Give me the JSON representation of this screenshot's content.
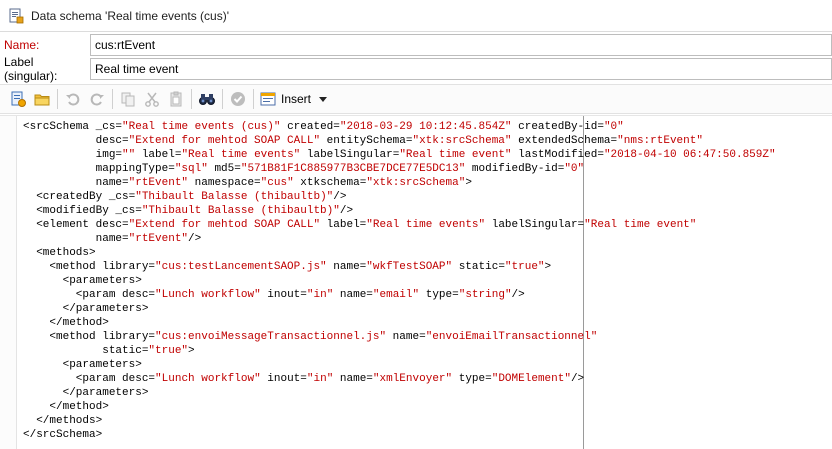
{
  "window": {
    "title": "Data schema 'Real time events (cus)'"
  },
  "form": {
    "name_label": "Name:",
    "name_value": "cus:rtEvent",
    "label_label": "Label (singular):",
    "label_value": "Real time event"
  },
  "toolbar": {
    "insert_label": "Insert",
    "icons": [
      "new-schema-icon",
      "open-folder-icon",
      "undo-icon",
      "redo-icon",
      "copy-icon",
      "cut-icon",
      "paste-icon",
      "find-binoculars-icon",
      "check-icon",
      "insert-icon",
      "dropdown-caret-icon"
    ]
  },
  "colors": {
    "attribute_value": "#c00000",
    "required_label": "#c00000",
    "margin_line": "#9a9a9a"
  },
  "code_lines": [
    [
      [
        "t",
        "<srcSchema "
      ],
      [
        "a",
        "_cs="
      ],
      [
        "v",
        "\"Real time events (cus)\""
      ],
      [
        "a",
        " created="
      ],
      [
        "v",
        "\"2018-03-29 10:12:45.854Z\""
      ],
      [
        "a",
        " createdBy-id="
      ],
      [
        "v",
        "\"0\""
      ]
    ],
    [
      [
        "a",
        "           desc="
      ],
      [
        "v",
        "\"Extend for mehtod SOAP CALL\""
      ],
      [
        "a",
        " entitySchema="
      ],
      [
        "v",
        "\"xtk:srcSchema\""
      ],
      [
        "a",
        " extendedSchema="
      ],
      [
        "v",
        "\"nms:rtEvent\""
      ]
    ],
    [
      [
        "a",
        "           img="
      ],
      [
        "v",
        "\"\""
      ],
      [
        "a",
        " label="
      ],
      [
        "v",
        "\"Real time events\""
      ],
      [
        "a",
        " labelSingular="
      ],
      [
        "v",
        "\"Real time event\""
      ],
      [
        "a",
        " lastModified="
      ],
      [
        "v",
        "\"2018-04-10 06:47:50.859Z\""
      ]
    ],
    [
      [
        "a",
        "           mappingType="
      ],
      [
        "v",
        "\"sql\""
      ],
      [
        "a",
        " md5="
      ],
      [
        "v",
        "\"571B81F1C885977B3CBE7DCE77E5DC13\""
      ],
      [
        "a",
        " modifiedBy-id="
      ],
      [
        "v",
        "\"0\""
      ]
    ],
    [
      [
        "a",
        "           name="
      ],
      [
        "v",
        "\"rtEvent\""
      ],
      [
        "a",
        " namespace="
      ],
      [
        "v",
        "\"cus\""
      ],
      [
        "a",
        " xtkschema="
      ],
      [
        "v",
        "\"xtk:srcSchema\""
      ],
      [
        "t",
        ">"
      ]
    ],
    [
      [
        "t",
        "  <createdBy "
      ],
      [
        "a",
        "_cs="
      ],
      [
        "v",
        "\"Thibault Balasse (thibaultb)\""
      ],
      [
        "t",
        "/>"
      ]
    ],
    [
      [
        "t",
        "  <modifiedBy "
      ],
      [
        "a",
        "_cs="
      ],
      [
        "v",
        "\"Thibault Balasse (thibaultb)\""
      ],
      [
        "t",
        "/>"
      ]
    ],
    [
      [
        "t",
        "  <element "
      ],
      [
        "a",
        "desc="
      ],
      [
        "v",
        "\"Extend for mehtod SOAP CALL\""
      ],
      [
        "a",
        " label="
      ],
      [
        "v",
        "\"Real time events\""
      ],
      [
        "a",
        " labelSingular="
      ],
      [
        "v",
        "\"Real time event\""
      ]
    ],
    [
      [
        "a",
        "           name="
      ],
      [
        "v",
        "\"rtEvent\""
      ],
      [
        "t",
        "/>"
      ]
    ],
    [
      [
        "t",
        "  <methods>"
      ]
    ],
    [
      [
        "t",
        "    <method "
      ],
      [
        "a",
        "library="
      ],
      [
        "v",
        "\"cus:testLancementSAOP.js\""
      ],
      [
        "a",
        " name="
      ],
      [
        "v",
        "\"wkfTestSOAP\""
      ],
      [
        "a",
        " static="
      ],
      [
        "v",
        "\"true\""
      ],
      [
        "t",
        ">"
      ]
    ],
    [
      [
        "t",
        "      <parameters>"
      ]
    ],
    [
      [
        "t",
        "        <param "
      ],
      [
        "a",
        "desc="
      ],
      [
        "v",
        "\"Lunch workflow\""
      ],
      [
        "a",
        " inout="
      ],
      [
        "v",
        "\"in\""
      ],
      [
        "a",
        " name="
      ],
      [
        "v",
        "\"email\""
      ],
      [
        "a",
        " type="
      ],
      [
        "v",
        "\"string\""
      ],
      [
        "t",
        "/>"
      ]
    ],
    [
      [
        "t",
        "      </parameters>"
      ]
    ],
    [
      [
        "t",
        "    </method>"
      ]
    ],
    [
      [
        "t",
        "    <method "
      ],
      [
        "a",
        "library="
      ],
      [
        "v",
        "\"cus:envoiMessageTransactionnel.js\""
      ],
      [
        "a",
        " name="
      ],
      [
        "v",
        "\"envoiEmailTransactionnel\""
      ]
    ],
    [
      [
        "a",
        "            static="
      ],
      [
        "v",
        "\"true\""
      ],
      [
        "t",
        ">"
      ]
    ],
    [
      [
        "t",
        "      <parameters>"
      ]
    ],
    [
      [
        "t",
        "        <param "
      ],
      [
        "a",
        "desc="
      ],
      [
        "v",
        "\"Lunch workflow\""
      ],
      [
        "a",
        " inout="
      ],
      [
        "v",
        "\"in\""
      ],
      [
        "a",
        " name="
      ],
      [
        "v",
        "\"xmlEnvoyer\""
      ],
      [
        "a",
        " type="
      ],
      [
        "v",
        "\"DOMElement\""
      ],
      [
        "t",
        "/>"
      ]
    ],
    [
      [
        "t",
        "      </parameters>"
      ]
    ],
    [
      [
        "t",
        "    </method>"
      ]
    ],
    [
      [
        "t",
        "  </methods>"
      ]
    ],
    [
      [
        "t",
        "</srcSchema>"
      ]
    ]
  ]
}
